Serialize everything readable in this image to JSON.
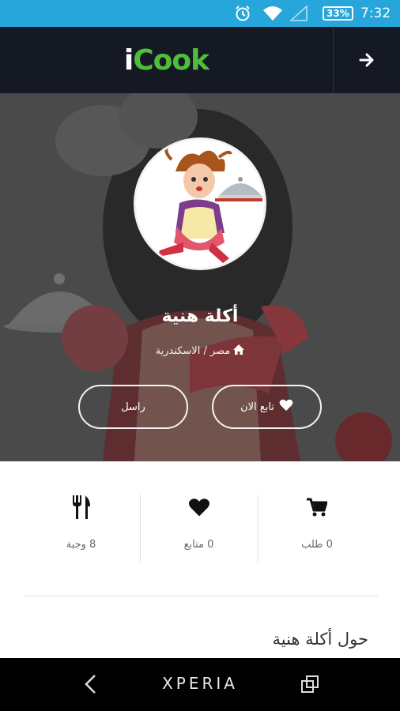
{
  "status_bar": {
    "battery": "33%",
    "time": "7:32",
    "icons": [
      "alarm-icon",
      "wifi-icon",
      "signal-icon",
      "battery-icon"
    ]
  },
  "app_bar": {
    "logo_prefix": "i",
    "logo_text": "Cook",
    "nav_icon": "arrow-right-icon"
  },
  "profile": {
    "name": "أكلة هنية",
    "location": "مصر / الاسكندرية",
    "follow_label": "تابع الان",
    "message_label": "راسل"
  },
  "stats": {
    "orders": "0 طلب",
    "followers": "0 متابع",
    "meals": "8 وجبة"
  },
  "about": {
    "title": "حول أكلة هنية"
  },
  "nav_bar": {
    "brand": "XPERIA"
  },
  "colors": {
    "status_bar": "#27a6dc",
    "app_bar": "#141924",
    "logo_green": "#4fbe3a"
  }
}
